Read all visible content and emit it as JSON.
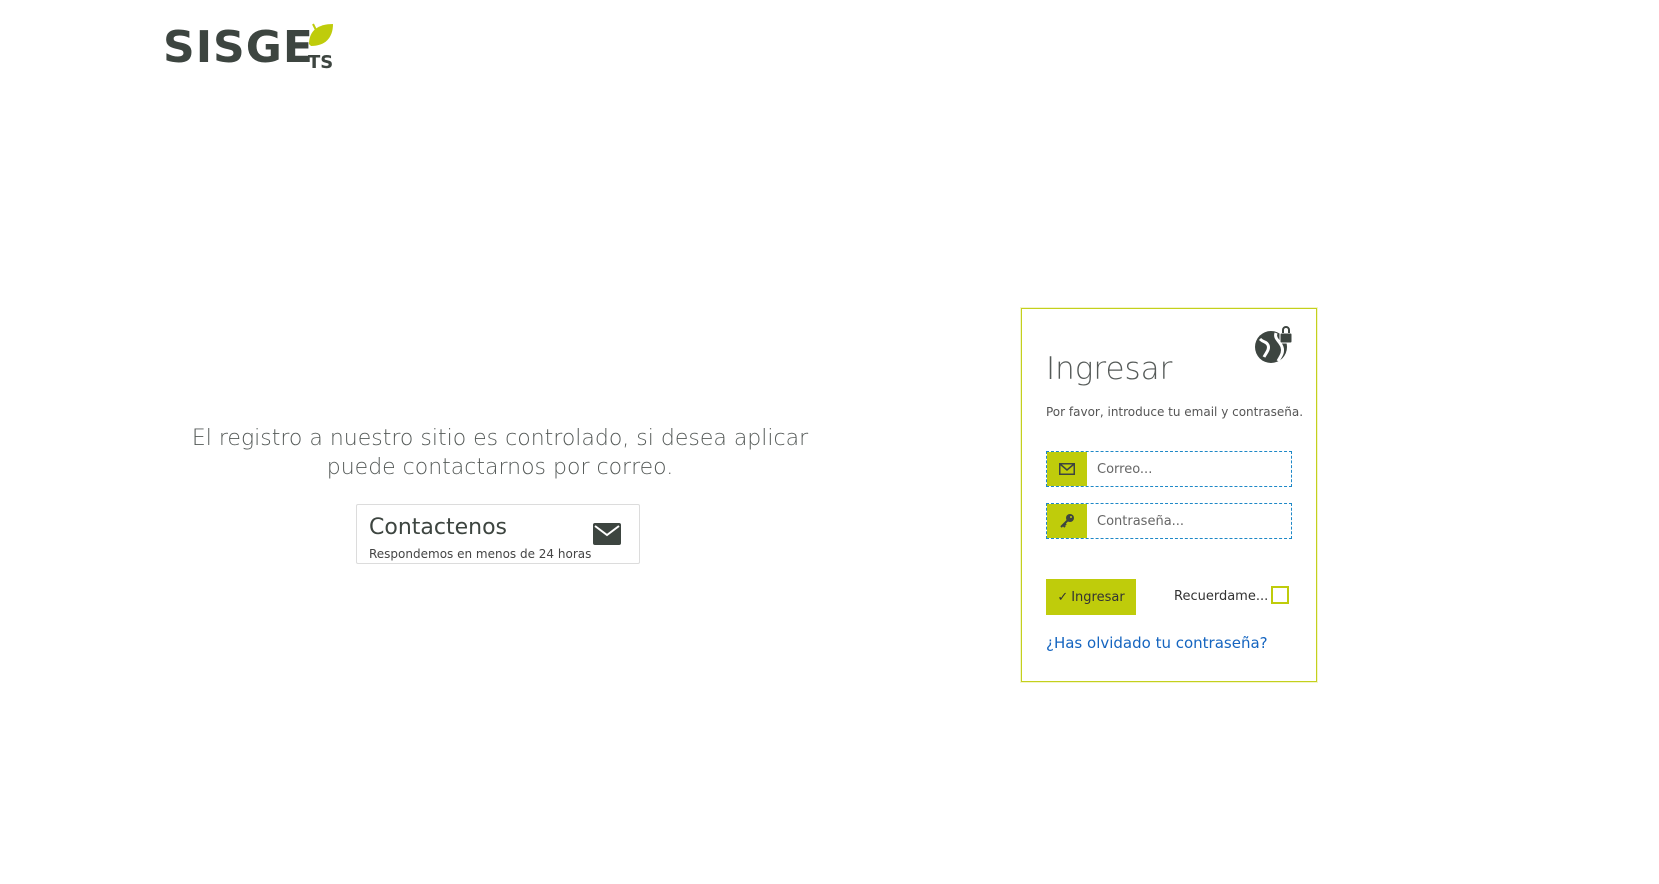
{
  "logo": {
    "main": "SISGE",
    "sub": "TS"
  },
  "register": {
    "message": "El registro a nuestro sitio es controlado, si desea aplicar puede contactarnos por correo."
  },
  "contact": {
    "title": "Contactenos",
    "subtitle": "Respondemos en menos de 24 horas",
    "icon": "mail-icon"
  },
  "login": {
    "title": "Ingresar",
    "hint": "Por favor, introduce tu email y contraseña.",
    "email_placeholder": "Correo...",
    "password_placeholder": "Contraseña...",
    "submit_label": "Ingresar",
    "remember_label": "Recuerdame...",
    "forgot_link": "¿Has olvidado tu contraseña?",
    "icons": {
      "header": "globe-lock-icon",
      "email": "envelope-icon",
      "password": "key-icon",
      "submit": "check-icon"
    }
  },
  "colors": {
    "accent": "#bfcc0b",
    "brand_dark": "#3d4540",
    "link": "#1565c0",
    "field_border": "#1e88c7"
  }
}
